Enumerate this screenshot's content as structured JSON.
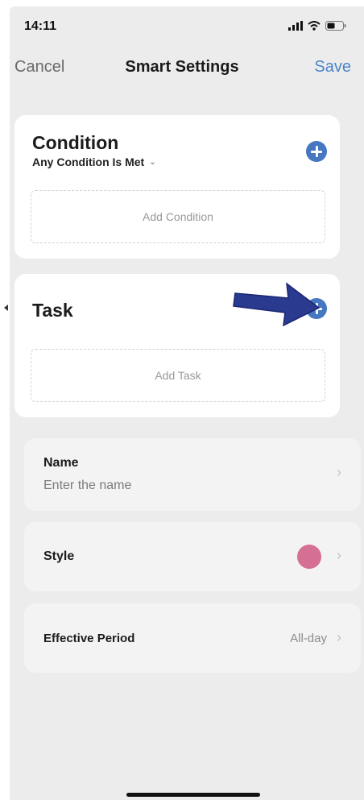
{
  "status_bar": {
    "time": "14:11",
    "icons": [
      "signal-icon",
      "wifi-icon",
      "battery-icon"
    ]
  },
  "nav": {
    "cancel_label": "Cancel",
    "title": "Smart Settings",
    "save_label": "Save"
  },
  "condition": {
    "title": "Condition",
    "mode": "Any Condition Is Met",
    "add_label": "Add Condition"
  },
  "task": {
    "title": "Task",
    "add_label": "Add Task"
  },
  "name_row": {
    "label": "Name",
    "placeholder": "Enter the name"
  },
  "style_row": {
    "label": "Style",
    "color": "#d66f94"
  },
  "period_row": {
    "label": "Effective Period",
    "value": "All-day"
  },
  "colors": {
    "accent": "#4677c1",
    "save": "#4d84c8",
    "annotation_arrow": "#2a3a8f"
  }
}
